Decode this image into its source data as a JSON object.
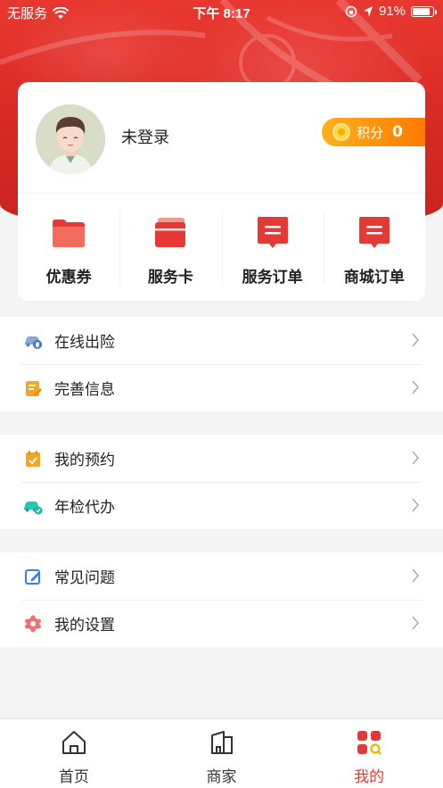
{
  "status_bar": {
    "carrier": "无服务",
    "time": "下午 8:17",
    "battery": "91%"
  },
  "profile": {
    "login_status": "未登录",
    "points_label": "积分",
    "points_value": "0"
  },
  "quick_actions": [
    {
      "label": "优惠券",
      "icon": "folder-icon"
    },
    {
      "label": "服务卡",
      "icon": "cards-icon"
    },
    {
      "label": "服务订单",
      "icon": "service-order-icon"
    },
    {
      "label": "商城订单",
      "icon": "mall-order-icon"
    }
  ],
  "menu": {
    "group1": [
      {
        "label": "在线出险",
        "icon": "car-insurance-icon"
      },
      {
        "label": "完善信息",
        "icon": "edit-document-icon"
      }
    ],
    "group2": [
      {
        "label": "我的预约",
        "icon": "calendar-check-icon"
      },
      {
        "label": "年检代办",
        "icon": "car-inspection-icon"
      }
    ],
    "group3": [
      {
        "label": "常见问题",
        "icon": "pencil-edit-icon"
      },
      {
        "label": "我的设置",
        "icon": "settings-gear-icon"
      }
    ]
  },
  "tab_bar": {
    "tabs": [
      {
        "label": "首页",
        "icon": "home-icon"
      },
      {
        "label": "商家",
        "icon": "store-icon"
      },
      {
        "label": "我的",
        "icon": "profile-grid-icon"
      }
    ],
    "active": "我的"
  },
  "colors": {
    "brand_red": "#e53935",
    "points_orange": "#ff8c0a"
  }
}
